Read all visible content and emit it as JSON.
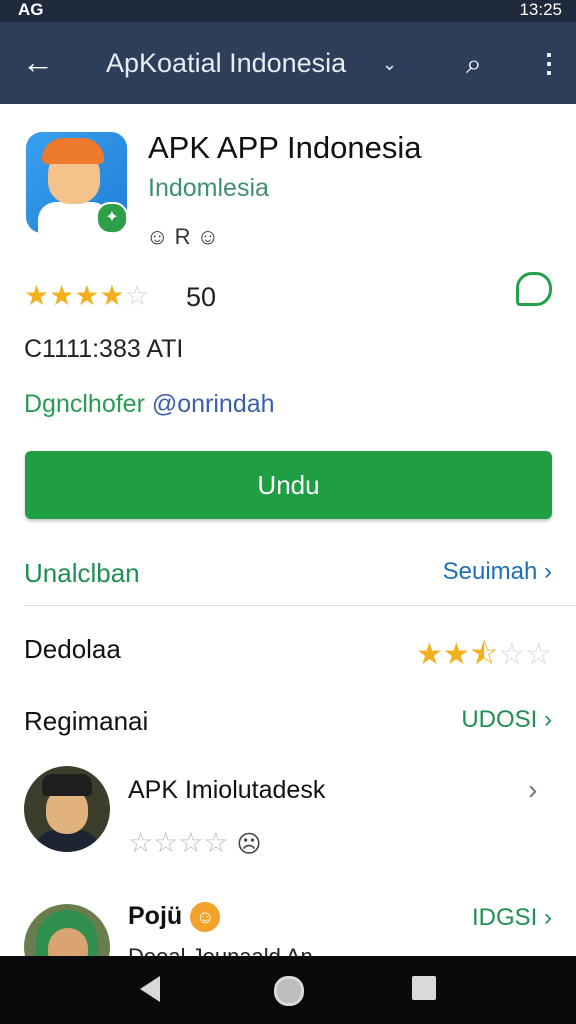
{
  "status_bar": {
    "left": "AG",
    "time": "13:25"
  },
  "app_bar": {
    "title": "ApKoatial Indonesia",
    "back_icon": "arrow-left-icon",
    "search_icon": "search-icon",
    "more_icon": "more-vert-icon"
  },
  "app": {
    "name": "APK APP Indonesia",
    "subtitle": "Indomlesia",
    "mini_icons": "☺ R ☺",
    "rating_value": "50",
    "rating_stars": 4,
    "meta_line": "C1111:383 ATI",
    "developer_prefix": "Dgnclhofer",
    "developer_handle": "@onrindah"
  },
  "install_button": {
    "label": "Undu"
  },
  "sections": [
    {
      "label": "Unalclban",
      "action": "Seuimah ›"
    },
    {
      "label": "Dedolaa",
      "action_rating_stars": 2.5
    },
    {
      "label": "Regimanai",
      "action": "UDOSI ›"
    }
  ],
  "reviews": [
    {
      "name": "APK Imiolutadesk",
      "stars": 0,
      "chevron": "›"
    },
    {
      "name": "Pojü",
      "action": "IDGSI ›",
      "text": "Deeal Jeunaald An"
    }
  ],
  "colors": {
    "app_bar": "#2c3e5a",
    "accent_green": "#1f9e44",
    "link_blue": "#1c6fb8",
    "star_gold": "#f2b01e"
  }
}
